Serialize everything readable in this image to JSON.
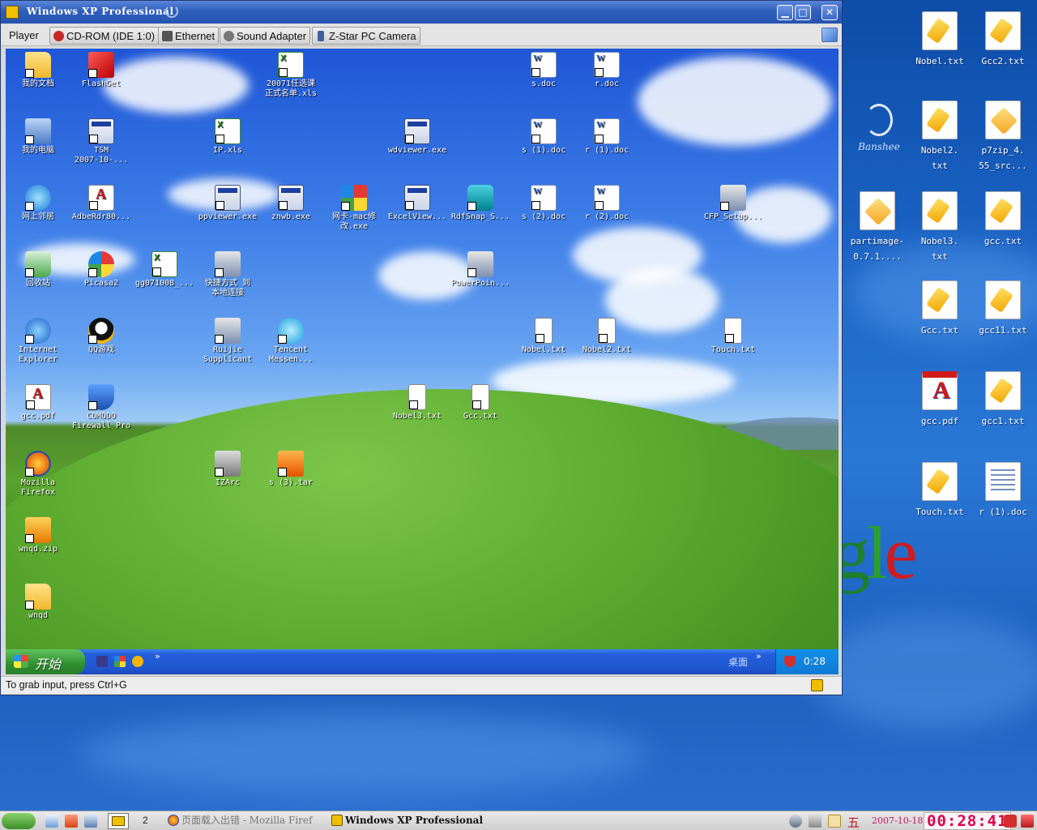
{
  "vm_window": {
    "title": "Windows XP Professional",
    "menu": {
      "player": "Player",
      "devices": [
        {
          "id": "cdrom",
          "label": "CD-ROM (IDE 1:0)",
          "icon": "cdrom-icon",
          "color": "#c62828"
        },
        {
          "id": "ethernet",
          "label": "Ethernet",
          "icon": "ethernet-icon",
          "color": "#555555"
        },
        {
          "id": "sound",
          "label": "Sound Adapter",
          "icon": "speaker-icon",
          "color": "#777777"
        },
        {
          "id": "camera",
          "label": "Z-Star PC Camera",
          "icon": "usb-icon",
          "color": "#3f5fa0"
        }
      ]
    },
    "status_text": "To grab input, press Ctrl+G"
  },
  "guest": {
    "desktop_icons": [
      {
        "label": "我的文档",
        "type": "folder"
      },
      {
        "label": "FlashGet",
        "type": "red"
      },
      {
        "label": "20071任选课\n正式名单.xls",
        "type": "xls"
      },
      {
        "label": "s.doc",
        "type": "doc"
      },
      {
        "label": "r.doc",
        "type": "doc"
      },
      {
        "label": "我的电脑",
        "type": "pc"
      },
      {
        "label": "TSM\n2007-10-...",
        "type": "exe"
      },
      {
        "label": "IP.xls",
        "type": "xls"
      },
      {
        "label": "wdviewer.exe",
        "type": "exe"
      },
      {
        "label": "s (1).doc",
        "type": "doc"
      },
      {
        "label": "r (1).doc",
        "type": "doc"
      },
      {
        "label": "网上邻居",
        "type": "globe"
      },
      {
        "label": "AdbeRdr80...",
        "type": "pdf"
      },
      {
        "label": "ppviewer.exe",
        "type": "exe"
      },
      {
        "label": "znwb.exe",
        "type": "exe"
      },
      {
        "label": "网卡-mac修\n改.exe",
        "type": "cube"
      },
      {
        "label": "ExcelView...",
        "type": "exe"
      },
      {
        "label": "RdfSnap_S...",
        "type": "camera"
      },
      {
        "label": "s (2).doc",
        "type": "doc"
      },
      {
        "label": "r (2).doc",
        "type": "doc"
      },
      {
        "label": "CFP_Setup...",
        "type": "network"
      },
      {
        "label": "回收站",
        "type": "recycle"
      },
      {
        "label": "Picasa2",
        "type": "pinwheel"
      },
      {
        "label": "gg071008_...",
        "type": "xls"
      },
      {
        "label": "快捷方式 到\n本地连接",
        "type": "network"
      },
      {
        "label": "PowerPoin...",
        "type": "network"
      },
      {
        "label": "Internet\nExplorer",
        "type": "ie"
      },
      {
        "label": "QQ游戏",
        "type": "qq"
      },
      {
        "label": "Ruijie\nSupplicant",
        "type": "network"
      },
      {
        "label": "Tencent\nMessen...",
        "type": "tencent"
      },
      {
        "label": "Nobel.txt",
        "type": "txt"
      },
      {
        "label": "Nobel2.txt",
        "type": "txt"
      },
      {
        "label": "Touch.txt",
        "type": "txt"
      },
      {
        "label": "gcc.pdf",
        "type": "pdf"
      },
      {
        "label": "COMODO\nFirewall Pro",
        "type": "shield"
      },
      {
        "label": "Nobel3.txt",
        "type": "txt"
      },
      {
        "label": "Gcc.txt",
        "type": "txt"
      },
      {
        "label": "Mozilla\nFirefox",
        "type": "firefox"
      },
      {
        "label": "IZArc",
        "type": "izarc"
      },
      {
        "label": "s (3).tar",
        "type": "tar"
      },
      {
        "label": "wnqd.zip",
        "type": "zip"
      },
      {
        "label": "wnqd",
        "type": "folder"
      }
    ],
    "taskbar": {
      "start_label": "开始",
      "more": "»",
      "desktop_label": "桌面",
      "clock": "0:28"
    }
  },
  "host": {
    "desktop_icons": [
      {
        "label": "Nobel.txt",
        "type": "txtpad"
      },
      {
        "label": "Gcc2.txt",
        "type": "txtpad"
      },
      {
        "label": "Nobel2.\ntxt",
        "type": "txtpad"
      },
      {
        "label": "p7zip_4.\n55_src...",
        "type": "pkg"
      },
      {
        "label": "partimage-\n0.7.1....",
        "type": "pkg"
      },
      {
        "label": "Nobel3.\ntxt",
        "type": "txtpad"
      },
      {
        "label": "gcc.txt",
        "type": "txtpad"
      },
      {
        "label": "Gcc.txt",
        "type": "txtpad"
      },
      {
        "label": "gcc11.txt",
        "type": "txtpad"
      },
      {
        "label": "gcc.pdf",
        "type": "pdf"
      },
      {
        "label": "gcc1.txt",
        "type": "txtpad"
      },
      {
        "label": "Touch.txt",
        "type": "txtpad"
      },
      {
        "label": "r (1).doc",
        "type": "docfile"
      }
    ],
    "banshee_label": "Banshee",
    "panel": {
      "workspace_number": "2",
      "tasks": [
        {
          "id": "firefox",
          "label": "页面载入出错 - Mozilla Firef"
        },
        {
          "id": "vmware",
          "label": "Windows XP Professional"
        }
      ],
      "ime": "五",
      "date": "2007-10-18",
      "clock": "00:28:41"
    }
  }
}
